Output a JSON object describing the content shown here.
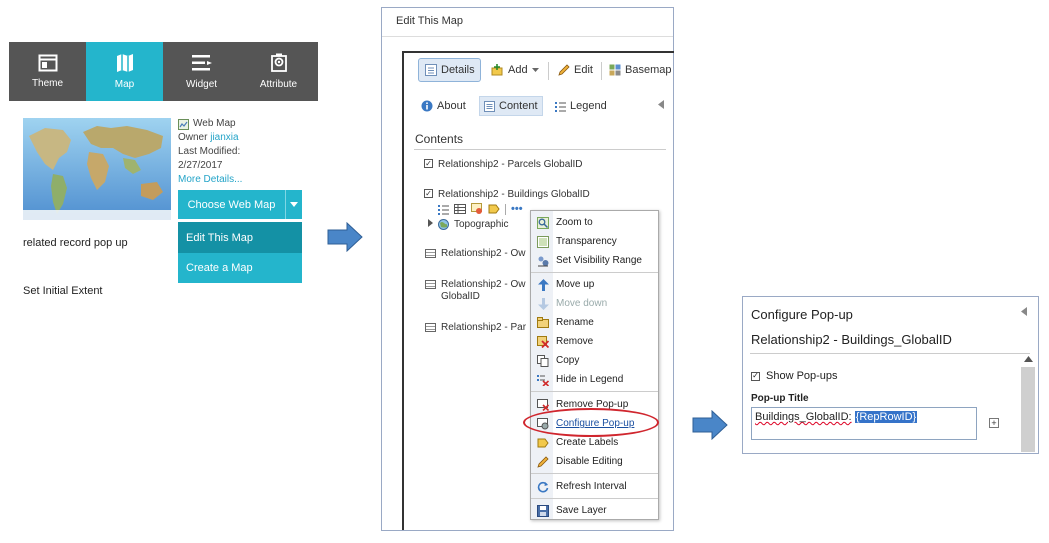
{
  "builder": {
    "tabs": [
      {
        "label": "Theme",
        "icon": "theme-icon"
      },
      {
        "label": "Map",
        "icon": "map-icon"
      },
      {
        "label": "Widget",
        "icon": "widget-icon"
      },
      {
        "label": "Attribute",
        "icon": "attribute-icon"
      }
    ],
    "active_tab": "Map",
    "meta": {
      "type_label": "Web Map",
      "owner_label": "Owner",
      "owner_name": "jianxia",
      "modified_label": "Last Modified:",
      "modified_date": "2/27/2017",
      "more_details": "More Details..."
    },
    "choose_button": "Choose Web Map",
    "menu": [
      "Edit This Map",
      "Create a Map"
    ],
    "related_text": "related record pop up",
    "set_initial_extent": "Set Initial Extent"
  },
  "edit_panel": {
    "title": "Edit This Map",
    "toolbar": {
      "details": "Details",
      "add": "Add",
      "edit": "Edit",
      "basemap": "Basemap"
    },
    "tabs": {
      "about": "About",
      "content": "Content",
      "legend": "Legend"
    },
    "contents_heading": "Contents",
    "layers": [
      "Relationship2 - Parcels GlobalID",
      "Relationship2 - Buildings GlobalID",
      "Topographic",
      "Relationship2 - Ow",
      "Relationship2 - Ow",
      "GlobalID",
      "Relationship2 - Par"
    ],
    "context_menu": [
      "Zoom to",
      "Transparency",
      "Set Visibility Range",
      "Move up",
      "Move down",
      "Rename",
      "Remove",
      "Copy",
      "Hide in Legend",
      "Remove Pop-up",
      "Configure Pop-up",
      "Create Labels",
      "Disable Editing",
      "Refresh Interval",
      "Save Layer"
    ]
  },
  "popup_panel": {
    "title": "Configure Pop-up",
    "layer_name": "Relationship2 - Buildings_GlobalID",
    "show_popups_label": "Show Pop-ups",
    "popup_title_label": "Pop-up Title",
    "popup_title_text": "Buildings_GlobalID:",
    "popup_title_field": "{RepRowID}"
  },
  "colors": {
    "accent": "#24b5cc",
    "accent_dark": "#1491a5",
    "highlight_oval": "#d0262e",
    "arrow": "#4a86c8"
  }
}
